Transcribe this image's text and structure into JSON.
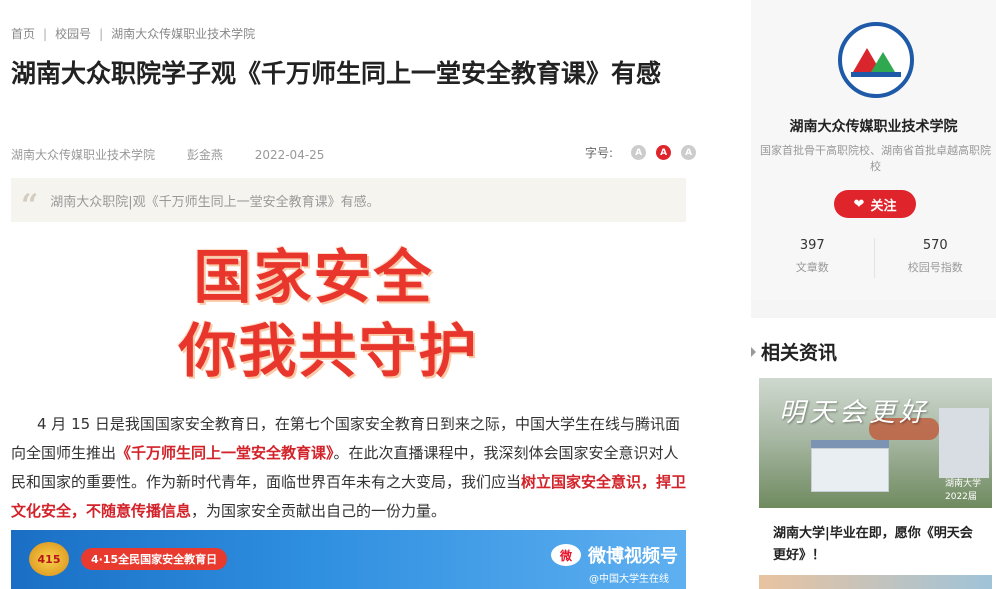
{
  "breadcrumb": [
    "首页",
    "校园号",
    "湖南大众传媒职业技术学院"
  ],
  "article": {
    "title": "湖南大众职院学子观《千万师生同上一堂安全教育课》有感",
    "source": "湖南大众传媒职业技术学院",
    "author": "彭金燕",
    "date": "2022-04-25",
    "font_size_label": "字号:",
    "font_size_options": [
      "A",
      "A",
      "A"
    ],
    "summary_quote": "“",
    "summary": "湖南大众职院|观《千万师生同上一堂安全教育课》有感。",
    "hero_lines": [
      "国家安全",
      "你我共守护"
    ],
    "paragraph": {
      "p1": "4 月 15 日是我国国家安全教育日，在第七个国家安全教育日到来之际，中国大学生在线与腾讯面向全国师生推出",
      "p1_red": "《千万师生同上一堂安全教育课》",
      "p2": "。在此次直播课程中，我深刻体会国家安全意识对人民和国家的重要性。作为新时代青年，面临世界百年未有之大变局，我们应当",
      "p2_red": "树立国家安全意识，捍卫文化安全，不随意传播信息",
      "p3": "，为国家安全贡献出自己的一份力量。"
    },
    "banner": {
      "badge": "415",
      "pill": "4·15全民国家安全教育日",
      "weibo_icon": "微",
      "weibo_text": "微博视频号",
      "handle": "@中国大学生在线"
    }
  },
  "sidebar": {
    "org_name": "湖南大众传媒职业技术学院",
    "org_desc": "国家首批骨干高职院校、湖南省首批卓越高职院校",
    "follow_label": "关注",
    "follow_icon": "heart-icon",
    "stats": [
      {
        "num": "397",
        "label": "文章数"
      },
      {
        "num": "570",
        "label": "校园号指数"
      }
    ],
    "related_title": "相关资讯",
    "related_items": [
      {
        "thumb_caption": "明天会更好",
        "thumb_signature": "湖南大学 2022届",
        "title": "湖南大学|毕业在即，愿你《明天会更好》！"
      }
    ]
  },
  "colors": {
    "accent_red": "#e0242b",
    "link_red": "#d2232a",
    "sidebar_bg": "#f5f5f5",
    "logo_blue": "#1e5aa8"
  }
}
